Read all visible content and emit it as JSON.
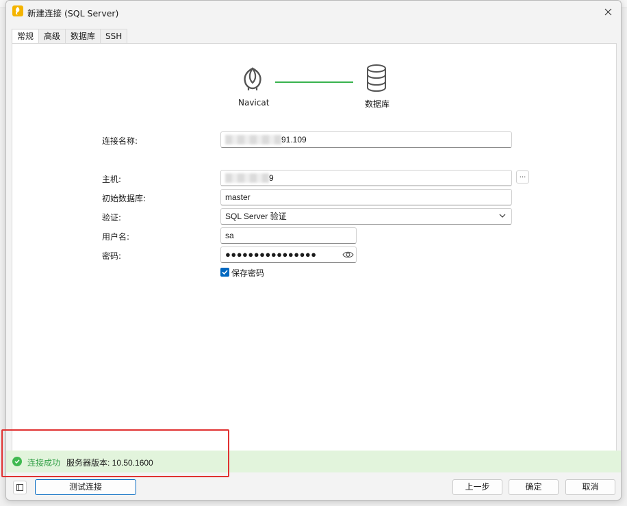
{
  "window": {
    "title": "新建连接 (SQL Server)"
  },
  "tabs": [
    {
      "label": "常规",
      "active": true
    },
    {
      "label": "高级",
      "active": false
    },
    {
      "label": "数据库",
      "active": false
    },
    {
      "label": "SSH",
      "active": false
    }
  ],
  "diagram": {
    "left_label": "Navicat",
    "right_label": "数据库",
    "line_color": "#37b24d"
  },
  "form": {
    "connection_name": {
      "label": "连接名称:",
      "visible_tail": "91.109"
    },
    "host": {
      "label": "主机:",
      "visible_tail": "9",
      "more_button": "..."
    },
    "initial_db": {
      "label": "初始数据库:",
      "value": "master"
    },
    "auth": {
      "label": "验证:",
      "value": "SQL Server 验证"
    },
    "username": {
      "label": "用户名:",
      "value": "sa"
    },
    "password": {
      "label": "密码:",
      "masked": "●●●●●●●●●●●●●●●●"
    },
    "save_password": {
      "label": "保存密码",
      "checked": true
    }
  },
  "status": {
    "text": "连接成功",
    "version": "服务器版本: 10.50.1600",
    "color": "#2f9e44"
  },
  "footer": {
    "test_button": "测试连接",
    "prev_button": "上一步",
    "ok_button": "确定",
    "cancel_button": "取消"
  }
}
